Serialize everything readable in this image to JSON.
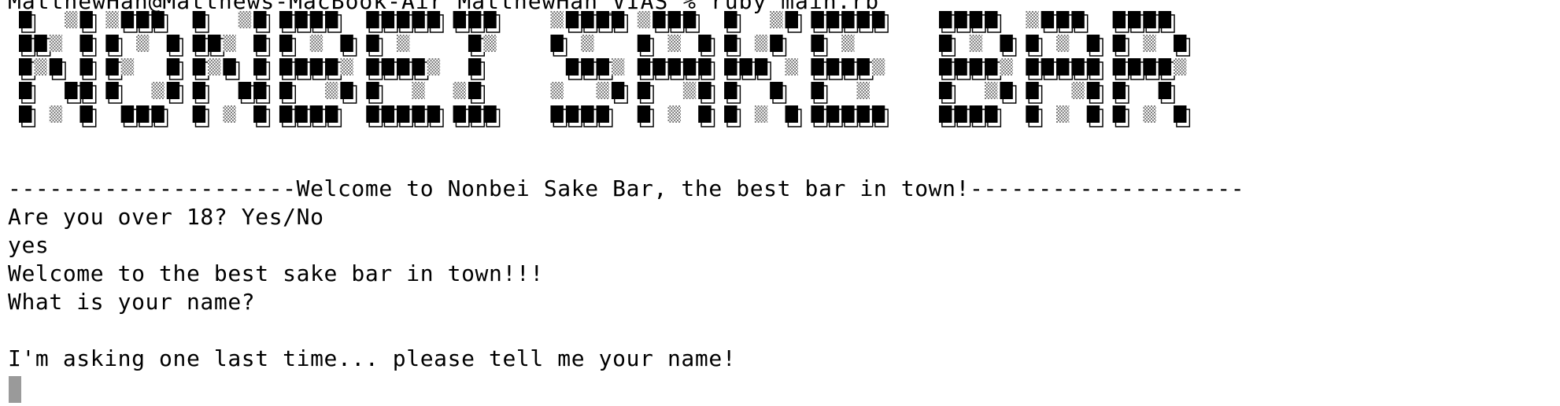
{
  "terminal": {
    "prompt": "MatthewHan@Matthews-MacBook-Air MatthewHan_VIAS % ruby main.rb",
    "banner_text": "Nonbei Sake Bar",
    "lines": [
      "---------------------Welcome to Nonbei Sake Bar, the best bar in town!--------------------",
      "Are you over 18? Yes/No",
      "yes",
      "Welcome to the best sake bar in town!!!",
      "What is your name?",
      "",
      "I'm asking one last time... please tell me your name!"
    ],
    "colors": {
      "background": "#ffffff",
      "text": "#000000",
      "cursor": "#9a9a9a"
    }
  }
}
